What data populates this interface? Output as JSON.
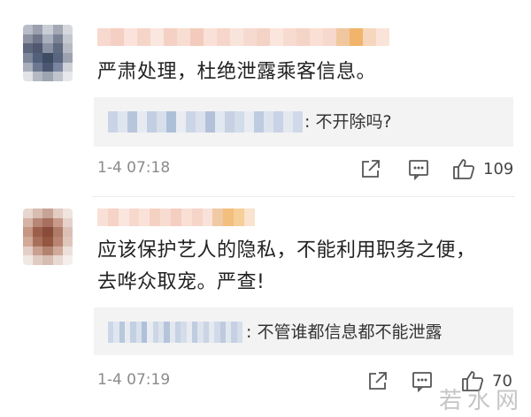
{
  "comments": [
    {
      "text_lines": [
        "严肃处理，杜绝泄露乘客信息。"
      ],
      "reply": {
        "text": ": 不开除吗?"
      },
      "time": "1-4 07:18",
      "likes": "109",
      "avatar_colors": [
        "#b8bcc8",
        "#9aa0ad",
        "#c9cdd6",
        "#a3a8b4",
        "#d6d8de",
        "#8d93a3",
        "#6f7689",
        "#aab0bd",
        "#7b8295",
        "#c4c8d0",
        "#5f677d",
        "#4f586f",
        "#8a91a3",
        "#606a80",
        "#b6bac4",
        "#7e879a",
        "#53607a",
        "#3f4a63",
        "#5a6580",
        "#9ca2b0",
        "#a8aebb",
        "#6d7890",
        "#4b5670",
        "#7a86a0",
        "#cfd2d8",
        "#e2e3e6",
        "#b5b9c2",
        "#9ea4b1",
        "#c0c4cc",
        "#e7e8eb"
      ],
      "name_colors": [
        "#f7d9cf",
        "#f4cfc3",
        "#fbe3db",
        "#f6d5c9",
        "#fae7df",
        "#f5d0c4",
        "#f8ddd3",
        "#f3cbbd",
        "#fae1d8",
        "#f6d6ca",
        "#f9e4dc",
        "#f7dacf",
        "#f4d3c7",
        "#fbe6de",
        "#f8dbd0",
        "#f5d4c8",
        "#fadfd5",
        "#f7d8cd",
        "#f1c79f",
        "#f0b56a",
        "#f6d7bd",
        "#fae4d9"
      ],
      "reply_colors": [
        "#c9d4e6",
        "#dfe5ef",
        "#b8c6dd",
        "#e6ebf2",
        "#c2cee2",
        "#d7dfeb",
        "#aebfd8",
        "#e9edf3",
        "#cbd5e6",
        "#dbe2ed",
        "#b3c2da",
        "#e2e8f0",
        "#c6d1e4",
        "#d3dce9",
        "#e8ecf2",
        "#bfcbe0",
        "#dde3ee",
        "#c9d3e5",
        "#e4e9f0",
        "#d0d9e8"
      ]
    },
    {
      "text_lines": [
        "应该保护艺人的隐私，不能利用职务之便，",
        "去哗众取宠。严查!"
      ],
      "reply": {
        "text": ": 不管谁都信息都不能泄露"
      },
      "time": "1-4 07:19",
      "likes": "70",
      "avatar_colors": [
        "#e8d6d0",
        "#d9bcb2",
        "#c7a396",
        "#e2ccc4",
        "#f0e4df",
        "#d5b3a6",
        "#b88676",
        "#a66f5f",
        "#c9998a",
        "#e6d2ca",
        "#c59684",
        "#9c5f4c",
        "#8a4c3a",
        "#b07a68",
        "#dcc0b5",
        "#d2a896",
        "#a8705c",
        "#93563f",
        "#b98572",
        "#e0c7bc",
        "#e4cfc6",
        "#c8a08f",
        "#b38370",
        "#cfa999",
        "#ede0da",
        "#f2e8e3",
        "#e0cbc2",
        "#d7bdb1",
        "#e8d9d2",
        "#f5eeea"
      ],
      "name_colors": [
        "#f9e0d6",
        "#f6d3c6",
        "#fbe6de",
        "#f7d8cc",
        "#fae2d9",
        "#f5d1c3",
        "#f8dcd1",
        "#f4ceC0",
        "#fadfd5",
        "#f6d5c8",
        "#f9e2d9",
        "#f1c9a4",
        "#f3bf7c",
        "#f6cf98",
        "#fae3cf"
      ],
      "reply_colors": [
        "#cbd6e7",
        "#e0e6ef",
        "#b9c7dd",
        "#e6ebf2",
        "#c3cfe2",
        "#d8e0eb",
        "#afc0d8",
        "#e9edf3",
        "#ccd6e6",
        "#dce3ed",
        "#b5c4db",
        "#e3e8f0",
        "#c7d2e4",
        "#d4dde9",
        "#e8ecf2",
        "#c0cce0",
        "#dee4ee",
        "#cad4e5",
        "#e5e9f0",
        "#d1dae8",
        "#bfcadf",
        "#e1e7ef",
        "#c5d0e3",
        "#d6deea"
      ]
    }
  ],
  "watermark": "若水网",
  "icons": {
    "share": "share-icon",
    "comment": "comment-icon",
    "like": "thumbs-up-icon"
  }
}
